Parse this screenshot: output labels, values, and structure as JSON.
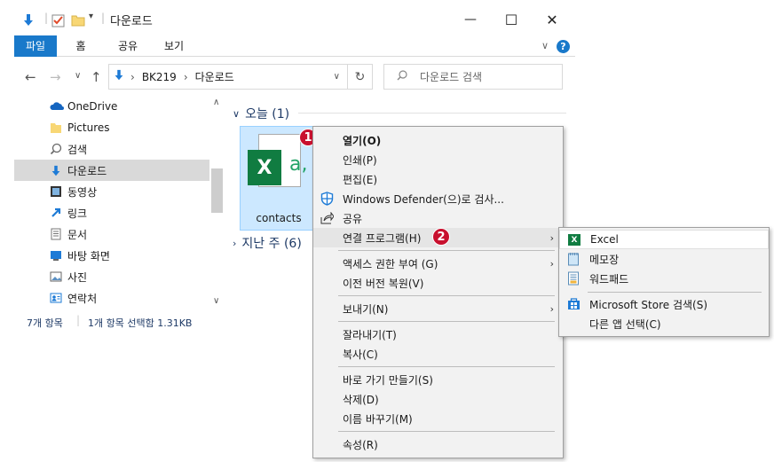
{
  "window": {
    "title": "다운로드",
    "minimize_glyph": "—",
    "maximize_glyph": "☐",
    "close_glyph": "✕"
  },
  "ribbon": {
    "tabs": [
      "파일",
      "홈",
      "공유",
      "보기"
    ],
    "expand_glyph": "∨",
    "help_glyph": "?"
  },
  "nav": {
    "back": "←",
    "forward": "→",
    "recent": "∨",
    "up": "↑",
    "breadcrumb": [
      "BK219",
      "다운로드"
    ],
    "breadcrumb_sep": "›",
    "dropdown": "∨",
    "refresh": "↻",
    "search_placeholder": "다운로드 검색"
  },
  "sidebar": {
    "items": [
      {
        "label": "OneDrive",
        "icon": "cloud-icon"
      },
      {
        "label": "Pictures",
        "icon": "folder-icon"
      },
      {
        "label": "검색",
        "icon": "search-icon"
      },
      {
        "label": "다운로드",
        "icon": "download-icon",
        "selected": true
      },
      {
        "label": "동영상",
        "icon": "video-icon"
      },
      {
        "label": "링크",
        "icon": "link-icon"
      },
      {
        "label": "문서",
        "icon": "document-icon"
      },
      {
        "label": "바탕 화면",
        "icon": "desktop-icon"
      },
      {
        "label": "사진",
        "icon": "photo-icon"
      },
      {
        "label": "연락처",
        "icon": "contacts-icon"
      }
    ]
  },
  "status": {
    "count": "7개 항목",
    "selection": "1개 항목 선택함 1.31KB"
  },
  "content": {
    "group_today": "오늘 (1)",
    "group_lastweek": "지난 주 (6)",
    "file_name": "contacts",
    "file_preview": "a,"
  },
  "context_menu": {
    "items": [
      "열기(O)",
      "인쇄(P)",
      "편집(E)",
      "Windows Defender(으)로 검사...",
      "공유",
      "연결 프로그램(H)",
      "액세스 권한 부여 (G)",
      "이전 버전 복원(V)",
      "보내기(N)",
      "잘라내기(T)",
      "복사(C)",
      "바로 가기 만들기(S)",
      "삭제(D)",
      "이름 바꾸기(M)",
      "속성(R)"
    ],
    "submenu_arrow": "›"
  },
  "open_with_menu": {
    "items": [
      {
        "label": "Excel",
        "icon": "excel-icon"
      },
      {
        "label": "메모장",
        "icon": "notepad-icon"
      },
      {
        "label": "워드패드",
        "icon": "wordpad-icon"
      },
      {
        "label": "Microsoft Store 검색(S)",
        "icon": "store-icon"
      },
      {
        "label": "다른 앱 선택(C)",
        "icon": ""
      }
    ]
  },
  "badges": {
    "one": "1",
    "two": "2"
  },
  "colors": {
    "accent": "#1979ca",
    "excel_green": "#107c41",
    "badge_red": "#c8102e",
    "selection": "#cce8ff"
  }
}
